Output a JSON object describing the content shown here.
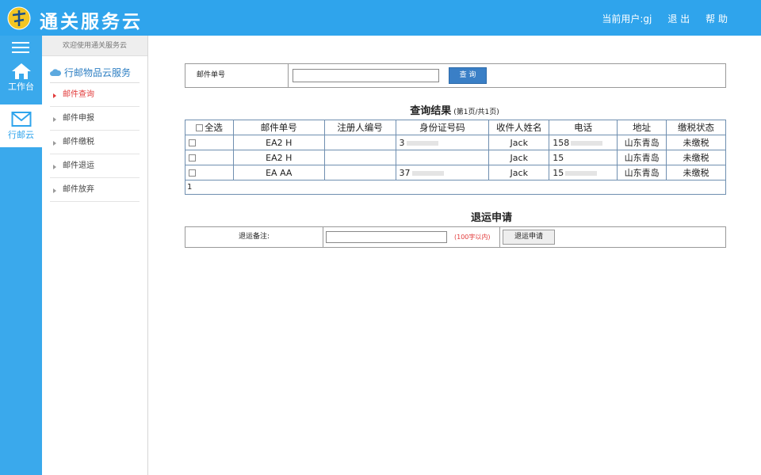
{
  "app": {
    "brand": "通关服务云",
    "topnav": {
      "current_user": "当前用户:gj",
      "logout": "退 出",
      "help": "帮 助"
    }
  },
  "rail": {
    "items": [
      {
        "label": "工作台",
        "icon": "home-icon"
      },
      {
        "label": "行邮云",
        "icon": "mail-icon",
        "active": true
      }
    ]
  },
  "subnav": {
    "welcome": "欢迎使用通关服务云",
    "title": "行邮物品云服务",
    "items": [
      {
        "label": "邮件查询",
        "active": true
      },
      {
        "label": "邮件申报"
      },
      {
        "label": "邮件缴税"
      },
      {
        "label": "邮件退运"
      },
      {
        "label": "邮件放弃"
      }
    ]
  },
  "search": {
    "label": "邮件单号",
    "value": "",
    "placeholder": "",
    "button": "查 询"
  },
  "results": {
    "title": "查询结果",
    "page_info": "(第1页/共1页)",
    "columns": [
      "全选",
      "邮件单号",
      "注册人编号",
      "身份证号码",
      "收件人姓名",
      "电话",
      "地址",
      "缴税状态"
    ],
    "rows": [
      {
        "mail_no": "EA2 H",
        "reg_no": "",
        "id_no": "3",
        "name": "Jack",
        "phone": "158",
        "address": "山东青岛",
        "tax_status": "未缴税"
      },
      {
        "mail_no": "EA2 H",
        "reg_no": "",
        "id_no": "",
        "name": "Jack",
        "phone": "15",
        "address": "山东青岛",
        "tax_status": "未缴税"
      },
      {
        "mail_no": "EA AA",
        "reg_no": "",
        "id_no": "37",
        "name": "Jack",
        "phone": "15",
        "address": "山东青岛",
        "tax_status": "未缴税"
      }
    ],
    "footer": "1"
  },
  "return_request": {
    "title": "退运申请",
    "label": "退运备注:",
    "value": "",
    "hint": "(100字以内)",
    "button": "退运申请"
  },
  "colors": {
    "header": "#2fa4ec",
    "rail": "#3aa9ec",
    "accent_red": "#e23b3b",
    "button_blue": "#3a7fc6"
  }
}
